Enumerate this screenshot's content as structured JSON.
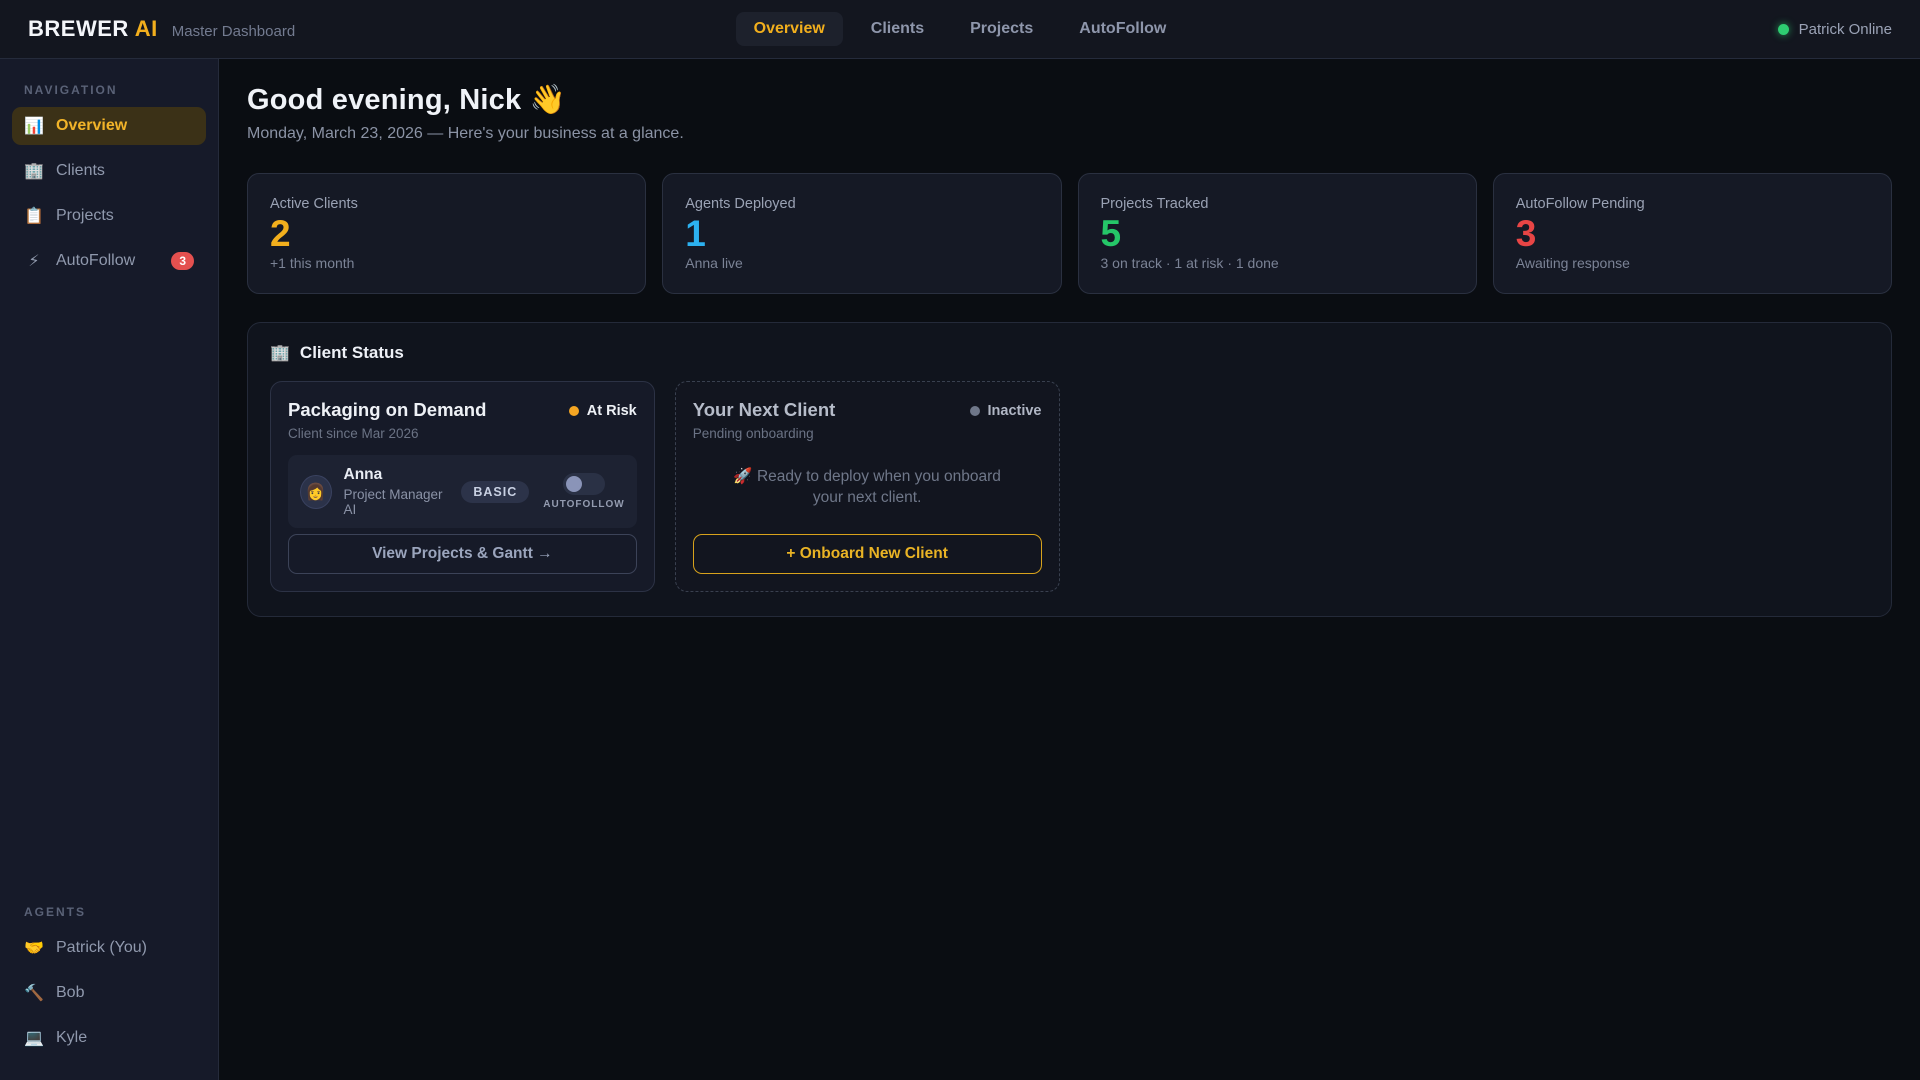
{
  "header": {
    "logo": {
      "brand": "BREWER",
      "accent": "AI"
    },
    "subtitle": "Master Dashboard",
    "nav": [
      {
        "label": "Overview",
        "active": true
      },
      {
        "label": "Clients",
        "active": false
      },
      {
        "label": "Projects",
        "active": false
      },
      {
        "label": "AutoFollow",
        "active": false
      }
    ],
    "user_status": {
      "label": "Patrick Online",
      "dot_color": "#2ecc71"
    }
  },
  "sidebar": {
    "nav_label": "NAVIGATION",
    "nav_items": [
      {
        "icon": "📊",
        "label": "Overview",
        "active": true
      },
      {
        "icon": "🏢",
        "label": "Clients",
        "active": false
      },
      {
        "icon": "📋",
        "label": "Projects",
        "active": false
      },
      {
        "icon": "⚡",
        "label": "AutoFollow",
        "active": false,
        "badge": "3"
      }
    ],
    "agents_label": "AGENTS",
    "agents": [
      {
        "icon": "🤝",
        "label": "Patrick (You)"
      },
      {
        "icon": "🔨",
        "label": "Bob"
      },
      {
        "icon": "💻",
        "label": "Kyle"
      }
    ]
  },
  "main": {
    "greeting": "Good evening, Nick 👋",
    "date_line": "Monday, March 23, 2026 — Here's your business at a glance.",
    "stats": [
      {
        "label": "Active Clients",
        "value": "2",
        "sub": "+1 this month",
        "color": "#f2af1d"
      },
      {
        "label": "Agents Deployed",
        "value": "1",
        "sub": "Anna live",
        "color": "#2cb1f0"
      },
      {
        "label": "Projects Tracked",
        "value": "5",
        "sub": "3 on track · 1 at risk · 1 done",
        "color": "#25c768"
      },
      {
        "label": "AutoFollow Pending",
        "value": "3",
        "sub": "Awaiting response",
        "color": "#e84545"
      }
    ],
    "client_status": {
      "icon": "🏢",
      "title": "Client Status",
      "client_card": {
        "name": "Packaging on Demand",
        "since": "Client since Mar 2026",
        "status": "At Risk",
        "status_color": "#f5a623",
        "agent": {
          "avatar": "👩",
          "name": "Anna",
          "role": "Project Manager AI",
          "tier": "BASIC",
          "toggle_label": "AUTOFOLLOW"
        },
        "action": "View Projects & Gantt →"
      },
      "next_card": {
        "title": "Your Next Client",
        "sub": "Pending onboarding",
        "status": "Inactive",
        "message": "🚀 Ready to deploy when you onboard your next client.",
        "action": "+ Onboard New Client"
      }
    }
  }
}
